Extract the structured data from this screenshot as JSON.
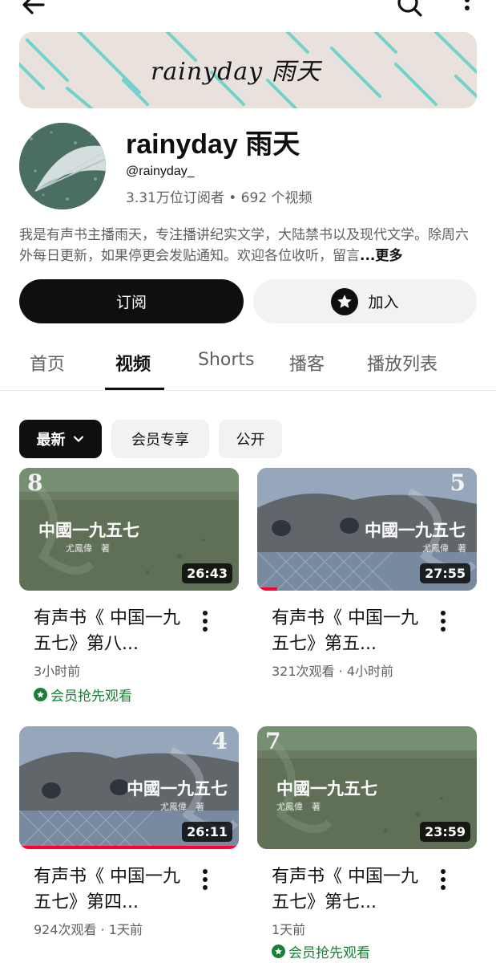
{
  "channel": {
    "banner_text": "rainyday 雨天",
    "name": "rainyday 雨天",
    "handle": "@rainyday_",
    "stats": "3.31万位订阅者 • 692 个视频",
    "description": "我是有声书主播雨天，专注播讲纪实文学，大陆禁书以及现代文学。除周六外每日更新，如果停更会发贴通知。欢迎各位收听，留言",
    "description_more": "...更多"
  },
  "actions": {
    "subscribe_label": "订阅",
    "join_label": "加入"
  },
  "tabs": [
    {
      "label": "首页"
    },
    {
      "label": "视频"
    },
    {
      "label": "Shorts"
    },
    {
      "label": "播客"
    },
    {
      "label": "播放列表"
    }
  ],
  "filters": [
    {
      "label": "最新"
    },
    {
      "label": "会员专享"
    },
    {
      "label": "公开"
    }
  ],
  "videos": [
    {
      "episode": "8",
      "thumb_title": "中國一九五七",
      "thumb_author": "尤鳳偉　著",
      "duration": "26:43",
      "title": "有声书《 中国一九五七》第八...",
      "meta": "3小时前",
      "badge": "会员抢先观看",
      "progress": 0
    },
    {
      "episode": "5",
      "thumb_title": "中國一九五七",
      "thumb_author": "尤鳳偉　著",
      "duration": "27:55",
      "title": "有声书《 中国一九五七》第五...",
      "meta": "321次观看 · 4小时前",
      "badge": "",
      "progress": 0.09
    },
    {
      "episode": "4",
      "thumb_title": "中國一九五七",
      "thumb_author": "尤鳳偉　著",
      "duration": "26:11",
      "title": "有声书《 中国一九五七》第四...",
      "meta": "924次观看 · 1天前",
      "badge": "",
      "progress": 1
    },
    {
      "episode": "7",
      "thumb_title": "中國一九五七",
      "thumb_author": "尤鳳偉　著",
      "duration": "23:59",
      "title": "有声书《 中国一九五七》第七...",
      "meta": "1天前",
      "badge": "会员抢先观看",
      "progress": 0
    }
  ],
  "colors": {
    "primary_text": "#0f0f0f",
    "secondary_text": "#606060",
    "member_green": "#1a7f37",
    "progress_red": "#ff0033"
  }
}
